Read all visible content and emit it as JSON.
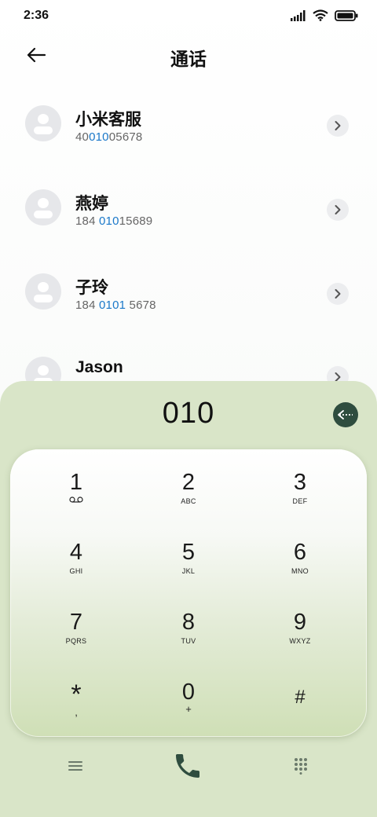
{
  "status_bar": {
    "time": "2:36"
  },
  "header": {
    "title": "通话"
  },
  "contacts": [
    {
      "name": "小米客服",
      "number_pre": "40",
      "number_hl": "010",
      "number_post": "05678"
    },
    {
      "name": "燕婷",
      "number_pre": "184 ",
      "number_hl": "010",
      "number_post": "15689"
    },
    {
      "name": "子玲",
      "number_pre": "184 ",
      "number_hl": "0101",
      "number_post": " 5678"
    },
    {
      "name": "Jason",
      "number_pre": "",
      "number_hl": "",
      "number_post": ""
    }
  ],
  "dialer": {
    "display": "010",
    "keys": [
      {
        "digit": "1",
        "letters": ""
      },
      {
        "digit": "2",
        "letters": "ABC"
      },
      {
        "digit": "3",
        "letters": "DEF"
      },
      {
        "digit": "4",
        "letters": "GHI"
      },
      {
        "digit": "5",
        "letters": "JKL"
      },
      {
        "digit": "6",
        "letters": "MNO"
      },
      {
        "digit": "7",
        "letters": "PQRS"
      },
      {
        "digit": "8",
        "letters": "TUV"
      },
      {
        "digit": "9",
        "letters": "WXYZ"
      },
      {
        "digit": "*",
        "letters": ","
      },
      {
        "digit": "0",
        "letters": "+"
      },
      {
        "digit": "#",
        "letters": ""
      }
    ]
  },
  "icons": {
    "back": "back-arrow-icon",
    "chevron": "chevron-right-icon",
    "backspace": "backspace-icon",
    "voicemail": "voicemail-icon",
    "menu": "menu-icon",
    "call": "phone-icon",
    "keypad": "keypad-grid-icon"
  },
  "colors": {
    "dialer_bg": "#d9e5c8",
    "highlight": "#1a78c9",
    "backspace_bg": "#2f4d3f",
    "call_icon": "#2f4d3f"
  }
}
